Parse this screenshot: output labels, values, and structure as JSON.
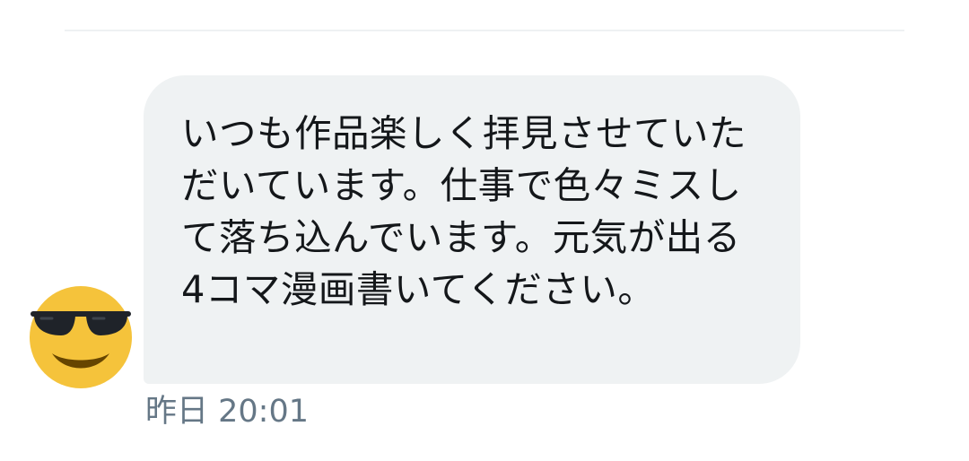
{
  "message": {
    "text": "いつも作品楽しく拝見させていただいています。仕事で色々ミスして落ち込んでいます。元気が出る4コマ漫画書いてください。",
    "timestamp": "昨日 20:01"
  },
  "avatar": {
    "icon": "sunglasses-emoji-icon",
    "face_color": "#f5c33b",
    "feature_color": "#664500"
  },
  "colors": {
    "bubble_bg": "#eff2f3",
    "text": "#14171a",
    "timestamp": "#657786"
  }
}
